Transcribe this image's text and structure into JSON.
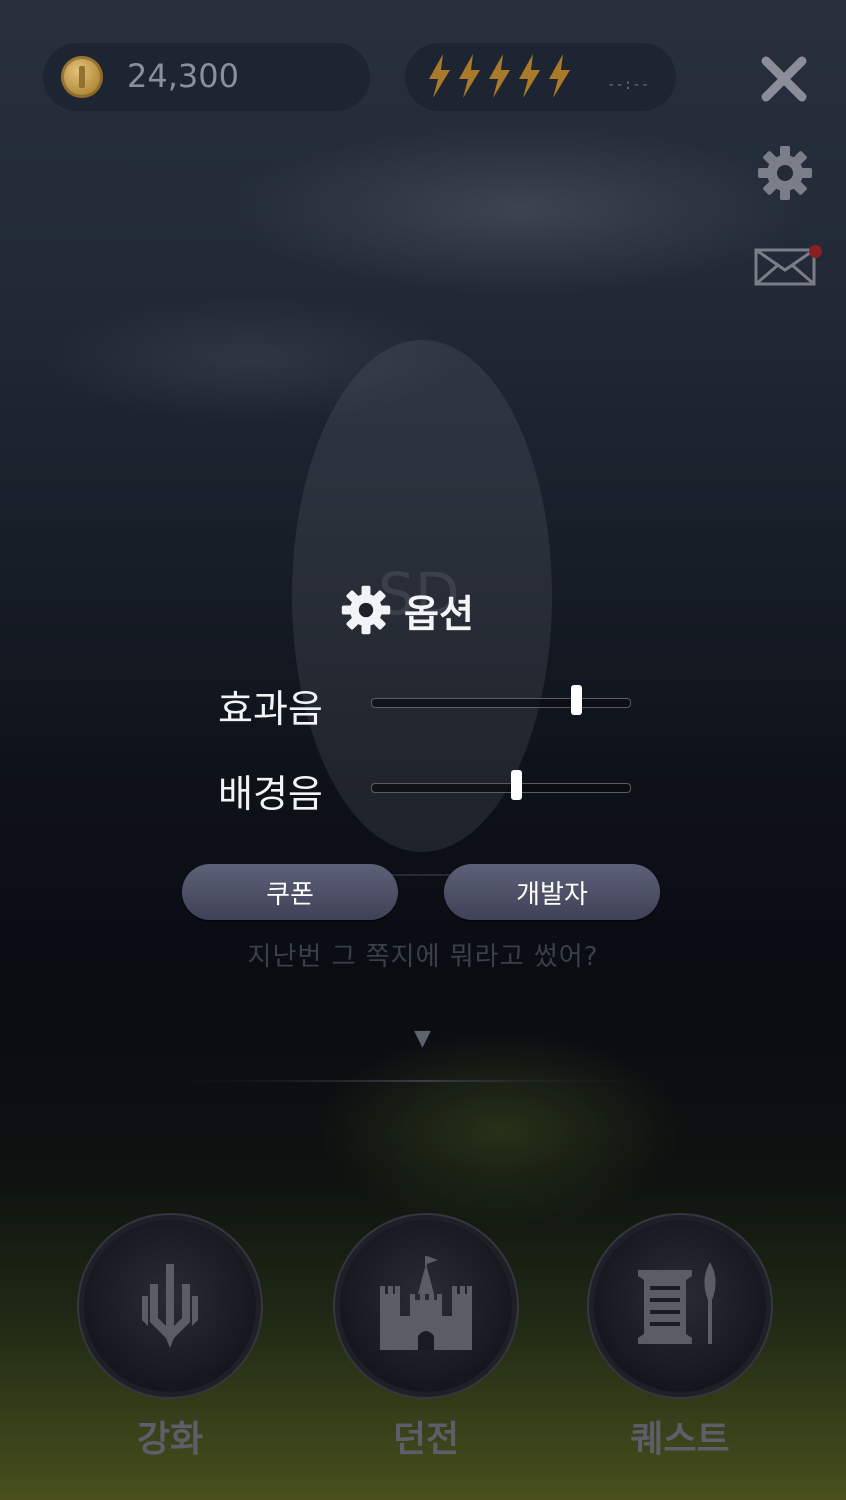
{
  "hud": {
    "coins": "24,300",
    "energy_count": 5,
    "timer": "--:--"
  },
  "icons": {
    "close": "close-icon",
    "settings": "gear-icon",
    "mail": "mail-icon",
    "coin": "coin-icon",
    "energy": "lightning-icon"
  },
  "colors": {
    "energy": "#a87a2a",
    "mail_notification": "#8a1f22",
    "button": "#4f5268"
  },
  "oval_watermark": "SD",
  "options": {
    "title": "옵션",
    "sfx_label": "효과음",
    "sfx_level": 0.79,
    "bgm_label": "배경음",
    "bgm_level": 0.56,
    "coupon_button": "쿠폰",
    "developer_button": "개발자"
  },
  "dialog": {
    "hint_text": "지난번 그 쪽지에 뭐라고 썼어?",
    "next_indicator": "▼"
  },
  "nav": {
    "items": [
      {
        "label": "강화",
        "icon": "sword-icon"
      },
      {
        "label": "던전",
        "icon": "castle-icon"
      },
      {
        "label": "퀘스트",
        "icon": "scroll-quill-icon"
      }
    ]
  }
}
